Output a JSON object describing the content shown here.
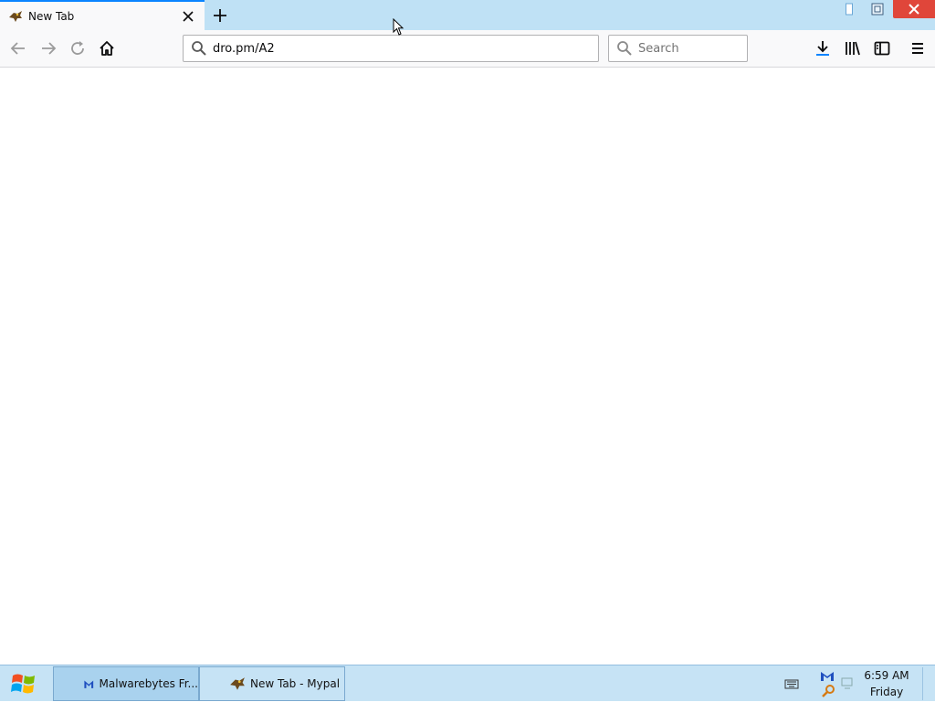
{
  "browser": {
    "tab": {
      "title": "New Tab"
    },
    "url": "dro.pm/A2",
    "search_placeholder": "Search"
  },
  "taskbar": {
    "items": [
      {
        "label": "Malwarebytes Fr...",
        "icon": "malwarebytes-icon"
      },
      {
        "label": "New Tab - Mypal",
        "icon": "mypal-icon"
      }
    ],
    "clock": {
      "time": "6:59 AM",
      "day": "Friday"
    }
  },
  "colors": {
    "tabstrip": "#bfe1f5",
    "accent": "#0a84ff",
    "close_button": "#e0463a",
    "taskbar": "#c6e3f5"
  }
}
